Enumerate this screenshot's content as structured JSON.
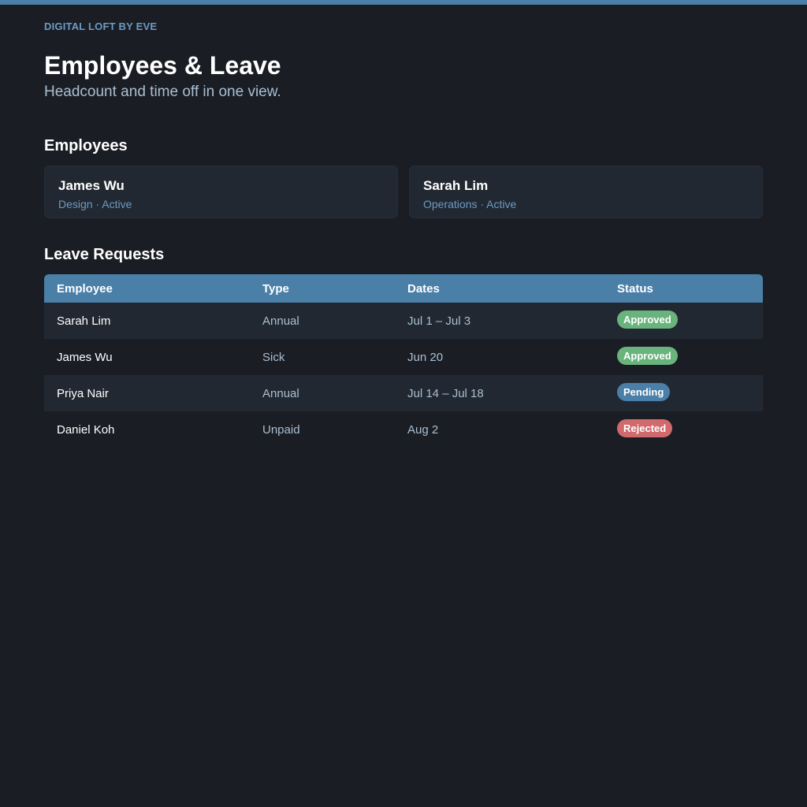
{
  "brand": "DIGITAL LOFT BY EVE",
  "header": {
    "title": "Employees & Leave",
    "subtitle": "Headcount and time off in one view."
  },
  "employees": {
    "heading": "Employees",
    "cards": [
      {
        "name": "James Wu",
        "department": "Design",
        "separator": "·",
        "status": "Active"
      },
      {
        "name": "Sarah Lim",
        "department": "Operations",
        "separator": "·",
        "status": "Active"
      }
    ]
  },
  "leave": {
    "heading": "Leave Requests",
    "columns": [
      "Employee",
      "Type",
      "Dates",
      "Status"
    ],
    "rows": [
      {
        "employee": "Sarah Lim",
        "type": "Annual",
        "dates": "Jul 1 – Jul 3",
        "status": "Approved"
      },
      {
        "employee": "James Wu",
        "type": "Sick",
        "dates": "Jun 20",
        "status": "Approved"
      },
      {
        "employee": "Priya Nair",
        "type": "Annual",
        "dates": "Jul 14 – Jul 18",
        "status": "Pending"
      },
      {
        "employee": "Daniel Koh",
        "type": "Unpaid",
        "dates": "Aug 2",
        "status": "Rejected"
      }
    ]
  },
  "colors": {
    "accent": "#4a7fa8",
    "background": "#1b1d24",
    "card": "#222831",
    "approved": "#69b37c",
    "pending": "#4a7fa8",
    "rejected": "#d06a6c"
  }
}
